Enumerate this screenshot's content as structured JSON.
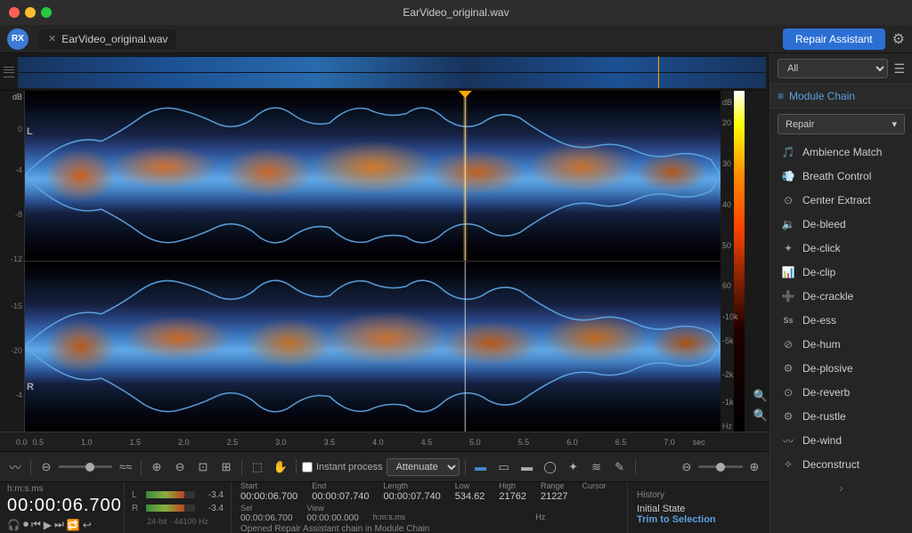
{
  "titlebar": {
    "title": "EarVideo_original.wav"
  },
  "tabs": [
    {
      "label": "EarVideo_original.wav",
      "active": true
    }
  ],
  "app_name": "RX",
  "repair_button": "Repair Assistant",
  "overview": {
    "channels": [
      "L",
      "R"
    ]
  },
  "time_ruler": {
    "markers": [
      "0.0",
      "0.5",
      "1.0",
      "1.5",
      "2.0",
      "2.5",
      "3.0",
      "3.5",
      "4.0",
      "4.5",
      "5.0",
      "5.5",
      "6.0",
      "6.5",
      "7.0"
    ],
    "unit": "sec"
  },
  "toolbar": {
    "instant_process_label": "Instant process",
    "attenuate_label": "Attenuate"
  },
  "statusbar": {
    "time_format": "h:m:s.ms",
    "timecode": "00:00:06.700",
    "transport_icons": [
      "headphones",
      "record",
      "rewind",
      "play",
      "fast-forward",
      "loop",
      "return"
    ],
    "sample_info": "24-bit · 44100 Hz",
    "meter_l_val": "-3.4",
    "meter_r_val": "-3.4",
    "sel_label": "Sel",
    "sel_start": "00:00:06.700",
    "view_label": "View",
    "view_start": "00:00:00.000",
    "end_label": "End",
    "end_val": "00:00:07.740",
    "length_label": "Length",
    "length_val": "00:00:07.740",
    "time_unit": "h:m:s.ms",
    "low_label": "Low",
    "low_val": "534.62",
    "high_label": "High",
    "high_val": "21762",
    "range_label": "Range",
    "range_val": "21227",
    "cursor_label": "Cursor",
    "hz_unit": "Hz",
    "status_text": "Opened Repair Assistant chain in Module Chain"
  },
  "history": {
    "title": "History",
    "items": [
      {
        "label": "Initial State"
      },
      {
        "label": "Trim to Selection",
        "active": true
      }
    ]
  },
  "right_panel": {
    "filter_label": "All",
    "module_chain_label": "Module Chain",
    "repair_category": "Repair",
    "modules": [
      {
        "name": "Ambience Match",
        "icon": "🎵"
      },
      {
        "name": "Breath Control",
        "icon": "💨"
      },
      {
        "name": "Center Extract",
        "icon": "⊙"
      },
      {
        "name": "De-bleed",
        "icon": "🔉"
      },
      {
        "name": "De-click",
        "icon": "✦"
      },
      {
        "name": "De-clip",
        "icon": "📊"
      },
      {
        "name": "De-crackle",
        "icon": "➕"
      },
      {
        "name": "De-ess",
        "icon": "Ss"
      },
      {
        "name": "De-hum",
        "icon": "⊘"
      },
      {
        "name": "De-plosive",
        "icon": "⚙"
      },
      {
        "name": "De-reverb",
        "icon": "⊙"
      },
      {
        "name": "De-rustle",
        "icon": "⚙"
      },
      {
        "name": "De-wind",
        "icon": "〰"
      },
      {
        "name": "Deconstruct",
        "icon": "✧"
      }
    ]
  }
}
